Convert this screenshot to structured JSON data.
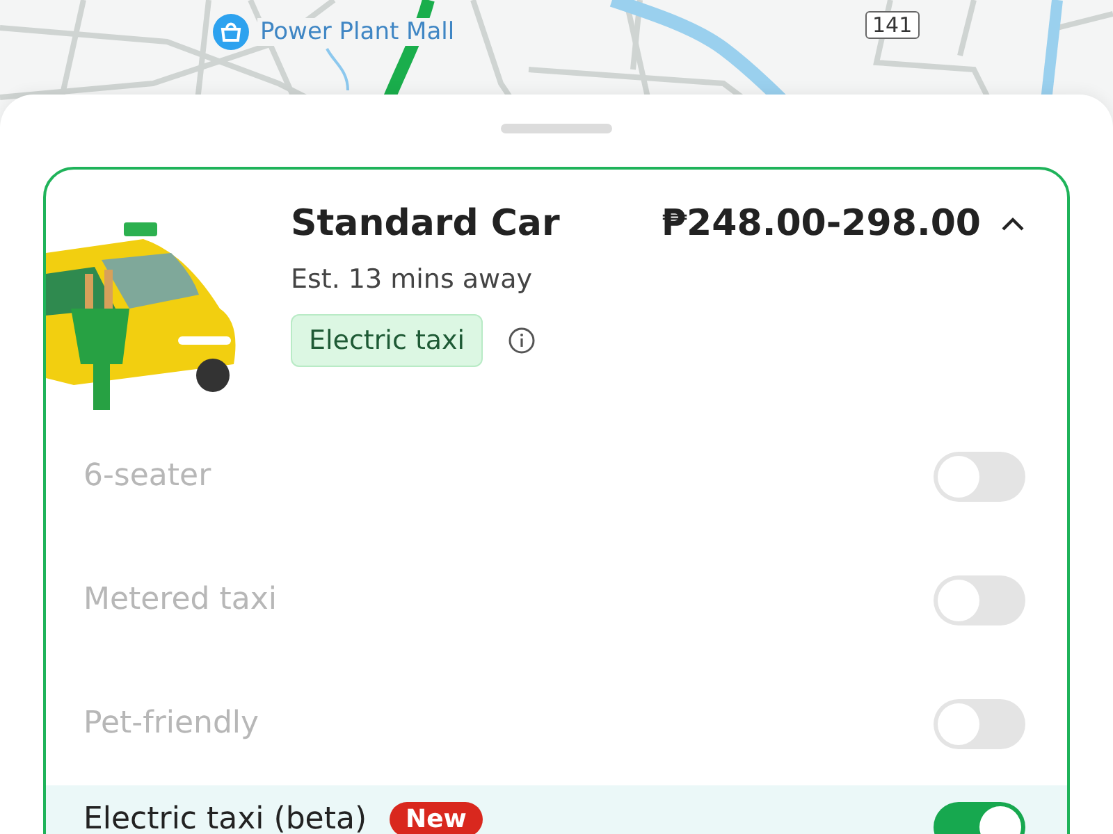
{
  "map": {
    "place_label": "Power Plant Mall",
    "road_number": "141"
  },
  "ride": {
    "name": "Standard Car",
    "price": "₱248.00-298.00",
    "expanded": true,
    "eta": "Est. 13 mins away",
    "tag": "Electric taxi"
  },
  "options": [
    {
      "label": "6-seater",
      "on": false,
      "disabled": true,
      "highlighted": false
    },
    {
      "label": "Metered taxi",
      "on": false,
      "disabled": true,
      "highlighted": false
    },
    {
      "label": "Pet-friendly",
      "on": false,
      "disabled": true,
      "highlighted": false
    },
    {
      "label": "Electric taxi (beta)",
      "badge": "New",
      "on": true,
      "disabled": false,
      "highlighted": true
    }
  ]
}
